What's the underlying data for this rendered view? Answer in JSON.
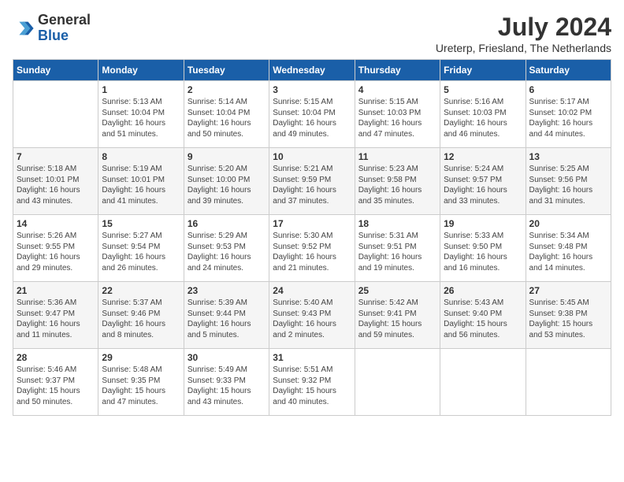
{
  "header": {
    "logo_general": "General",
    "logo_blue": "Blue",
    "title": "July 2024",
    "subtitle": "Ureterp, Friesland, The Netherlands"
  },
  "days_of_week": [
    "Sunday",
    "Monday",
    "Tuesday",
    "Wednesday",
    "Thursday",
    "Friday",
    "Saturday"
  ],
  "weeks": [
    [
      {
        "day": "",
        "content": ""
      },
      {
        "day": "1",
        "content": "Sunrise: 5:13 AM\nSunset: 10:04 PM\nDaylight: 16 hours\nand 51 minutes."
      },
      {
        "day": "2",
        "content": "Sunrise: 5:14 AM\nSunset: 10:04 PM\nDaylight: 16 hours\nand 50 minutes."
      },
      {
        "day": "3",
        "content": "Sunrise: 5:15 AM\nSunset: 10:04 PM\nDaylight: 16 hours\nand 49 minutes."
      },
      {
        "day": "4",
        "content": "Sunrise: 5:15 AM\nSunset: 10:03 PM\nDaylight: 16 hours\nand 47 minutes."
      },
      {
        "day": "5",
        "content": "Sunrise: 5:16 AM\nSunset: 10:03 PM\nDaylight: 16 hours\nand 46 minutes."
      },
      {
        "day": "6",
        "content": "Sunrise: 5:17 AM\nSunset: 10:02 PM\nDaylight: 16 hours\nand 44 minutes."
      }
    ],
    [
      {
        "day": "7",
        "content": "Sunrise: 5:18 AM\nSunset: 10:01 PM\nDaylight: 16 hours\nand 43 minutes."
      },
      {
        "day": "8",
        "content": "Sunrise: 5:19 AM\nSunset: 10:01 PM\nDaylight: 16 hours\nand 41 minutes."
      },
      {
        "day": "9",
        "content": "Sunrise: 5:20 AM\nSunset: 10:00 PM\nDaylight: 16 hours\nand 39 minutes."
      },
      {
        "day": "10",
        "content": "Sunrise: 5:21 AM\nSunset: 9:59 PM\nDaylight: 16 hours\nand 37 minutes."
      },
      {
        "day": "11",
        "content": "Sunrise: 5:23 AM\nSunset: 9:58 PM\nDaylight: 16 hours\nand 35 minutes."
      },
      {
        "day": "12",
        "content": "Sunrise: 5:24 AM\nSunset: 9:57 PM\nDaylight: 16 hours\nand 33 minutes."
      },
      {
        "day": "13",
        "content": "Sunrise: 5:25 AM\nSunset: 9:56 PM\nDaylight: 16 hours\nand 31 minutes."
      }
    ],
    [
      {
        "day": "14",
        "content": "Sunrise: 5:26 AM\nSunset: 9:55 PM\nDaylight: 16 hours\nand 29 minutes."
      },
      {
        "day": "15",
        "content": "Sunrise: 5:27 AM\nSunset: 9:54 PM\nDaylight: 16 hours\nand 26 minutes."
      },
      {
        "day": "16",
        "content": "Sunrise: 5:29 AM\nSunset: 9:53 PM\nDaylight: 16 hours\nand 24 minutes."
      },
      {
        "day": "17",
        "content": "Sunrise: 5:30 AM\nSunset: 9:52 PM\nDaylight: 16 hours\nand 21 minutes."
      },
      {
        "day": "18",
        "content": "Sunrise: 5:31 AM\nSunset: 9:51 PM\nDaylight: 16 hours\nand 19 minutes."
      },
      {
        "day": "19",
        "content": "Sunrise: 5:33 AM\nSunset: 9:50 PM\nDaylight: 16 hours\nand 16 minutes."
      },
      {
        "day": "20",
        "content": "Sunrise: 5:34 AM\nSunset: 9:48 PM\nDaylight: 16 hours\nand 14 minutes."
      }
    ],
    [
      {
        "day": "21",
        "content": "Sunrise: 5:36 AM\nSunset: 9:47 PM\nDaylight: 16 hours\nand 11 minutes."
      },
      {
        "day": "22",
        "content": "Sunrise: 5:37 AM\nSunset: 9:46 PM\nDaylight: 16 hours\nand 8 minutes."
      },
      {
        "day": "23",
        "content": "Sunrise: 5:39 AM\nSunset: 9:44 PM\nDaylight: 16 hours\nand 5 minutes."
      },
      {
        "day": "24",
        "content": "Sunrise: 5:40 AM\nSunset: 9:43 PM\nDaylight: 16 hours\nand 2 minutes."
      },
      {
        "day": "25",
        "content": "Sunrise: 5:42 AM\nSunset: 9:41 PM\nDaylight: 15 hours\nand 59 minutes."
      },
      {
        "day": "26",
        "content": "Sunrise: 5:43 AM\nSunset: 9:40 PM\nDaylight: 15 hours\nand 56 minutes."
      },
      {
        "day": "27",
        "content": "Sunrise: 5:45 AM\nSunset: 9:38 PM\nDaylight: 15 hours\nand 53 minutes."
      }
    ],
    [
      {
        "day": "28",
        "content": "Sunrise: 5:46 AM\nSunset: 9:37 PM\nDaylight: 15 hours\nand 50 minutes."
      },
      {
        "day": "29",
        "content": "Sunrise: 5:48 AM\nSunset: 9:35 PM\nDaylight: 15 hours\nand 47 minutes."
      },
      {
        "day": "30",
        "content": "Sunrise: 5:49 AM\nSunset: 9:33 PM\nDaylight: 15 hours\nand 43 minutes."
      },
      {
        "day": "31",
        "content": "Sunrise: 5:51 AM\nSunset: 9:32 PM\nDaylight: 15 hours\nand 40 minutes."
      },
      {
        "day": "",
        "content": ""
      },
      {
        "day": "",
        "content": ""
      },
      {
        "day": "",
        "content": ""
      }
    ]
  ]
}
